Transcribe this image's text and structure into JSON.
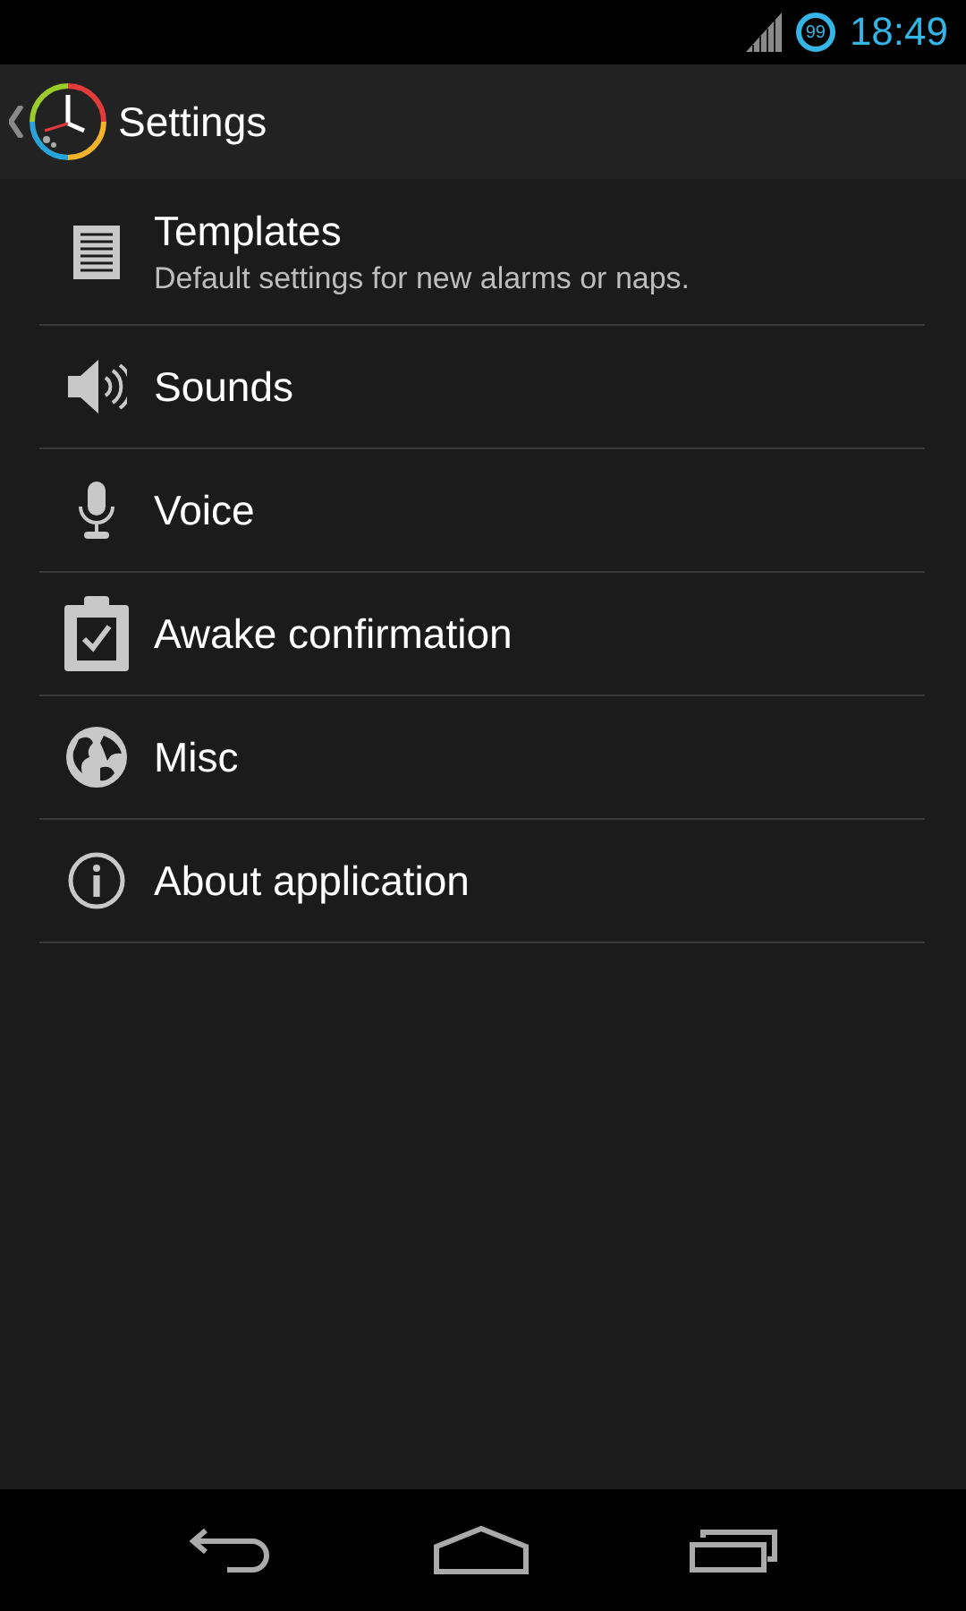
{
  "status_bar": {
    "battery": "99",
    "time": "18:49"
  },
  "action_bar": {
    "title": "Settings"
  },
  "items": [
    {
      "kind": "document",
      "title": "Templates",
      "summary": "Default settings for new alarms or naps."
    },
    {
      "kind": "speaker",
      "title": "Sounds"
    },
    {
      "kind": "microphone",
      "title": "Voice"
    },
    {
      "kind": "clipboard",
      "title": "Awake confirmation"
    },
    {
      "kind": "globe",
      "title": "Misc"
    },
    {
      "kind": "info",
      "title": "About application"
    }
  ]
}
